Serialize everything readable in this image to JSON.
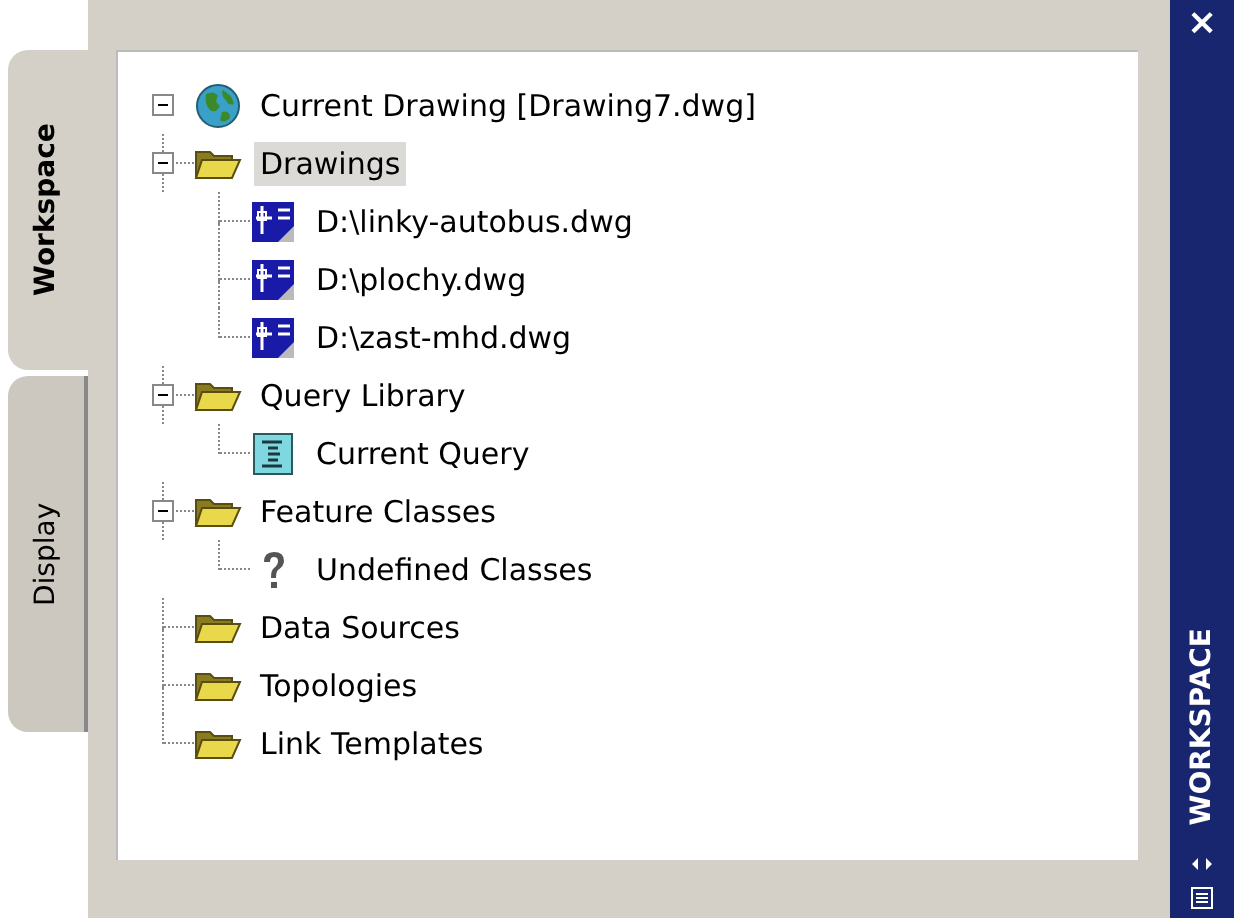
{
  "tabs": [
    {
      "label": "Workspace",
      "selected": true
    },
    {
      "label": "Display",
      "selected": false
    }
  ],
  "tree": {
    "label": "Current Drawing [Drawing7.dwg]",
    "kind": "globe",
    "expanded": true,
    "selected": false,
    "children": [
      {
        "label": "Drawings",
        "kind": "folder",
        "expanded": true,
        "selected": true,
        "children": [
          {
            "label": "D:\\linky-autobus.dwg",
            "kind": "drawing",
            "selected": false
          },
          {
            "label": "D:\\plochy.dwg",
            "kind": "drawing",
            "selected": false
          },
          {
            "label": "D:\\zast-mhd.dwg",
            "kind": "drawing",
            "selected": false
          }
        ]
      },
      {
        "label": "Query Library",
        "kind": "folder",
        "expanded": true,
        "selected": false,
        "children": [
          {
            "label": "Current Query",
            "kind": "query",
            "selected": false
          }
        ]
      },
      {
        "label": "Feature Classes",
        "kind": "folder",
        "expanded": true,
        "selected": false,
        "children": [
          {
            "label": "Undefined Classes",
            "kind": "unknown",
            "selected": false
          }
        ]
      },
      {
        "label": "Data Sources",
        "kind": "folder",
        "selected": false
      },
      {
        "label": "Topologies",
        "kind": "folder",
        "selected": false
      },
      {
        "label": "Link Templates",
        "kind": "folder",
        "selected": false
      }
    ]
  },
  "palette": {
    "close": "×",
    "title": "WORKSPACE"
  }
}
